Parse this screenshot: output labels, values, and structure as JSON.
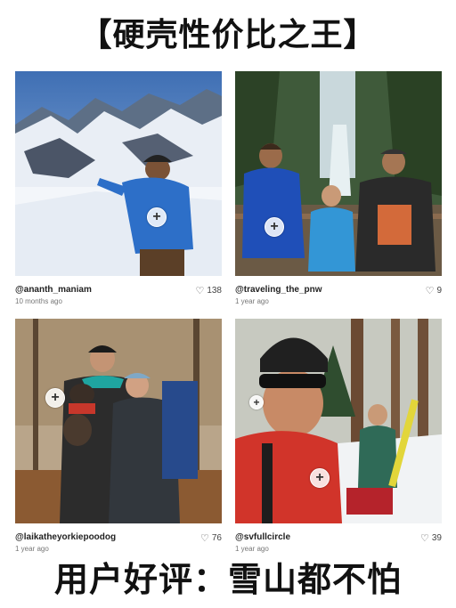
{
  "banner_top": "【硬壳性价比之王】",
  "banner_bottom": "用户好评：雪山都不怕",
  "posts": [
    {
      "handle": "@ananth_maniam",
      "time": "10 months ago",
      "likes": "138"
    },
    {
      "handle": "@traveling_the_pnw",
      "time": "1 year ago",
      "likes": "9"
    },
    {
      "handle": "@laikatheyorkiepoodog",
      "time": "1 year ago",
      "likes": "76"
    },
    {
      "handle": "@svfullcircle",
      "time": "1 year ago",
      "likes": "39"
    }
  ],
  "icons": {
    "add": "plus-circle-icon",
    "like": "heart-icon"
  }
}
